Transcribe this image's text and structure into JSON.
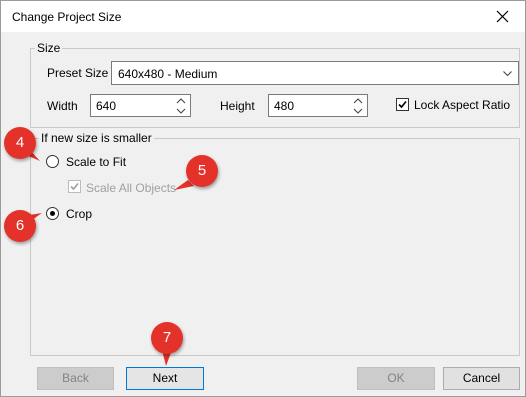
{
  "window": {
    "title": "Change Project Size"
  },
  "size_group": {
    "legend": "Size",
    "preset_label": "Preset Size",
    "preset_value": "640x480 - Medium",
    "width_label": "Width",
    "width_value": "640",
    "height_label": "Height",
    "height_value": "480",
    "lock_label": "Lock Aspect Ratio",
    "lock_checked": true
  },
  "smaller_group": {
    "legend": "If new size is smaller",
    "scale_label": "Scale to Fit",
    "scale_all_label": "Scale All Objects",
    "crop_label": "Crop",
    "selected": "Crop"
  },
  "buttons": {
    "back": "Back",
    "next": "Next",
    "ok": "OK",
    "cancel": "Cancel"
  },
  "markers": [
    "4",
    "5",
    "6",
    "7"
  ],
  "colors": {
    "marker": "#e4322a",
    "default_button_border": "#0078d7"
  },
  "icons": {
    "close": "close-icon",
    "dropdown": "chevron-down-icon",
    "spin": "spinner-arrows-icon",
    "check": "checkmark-icon"
  }
}
